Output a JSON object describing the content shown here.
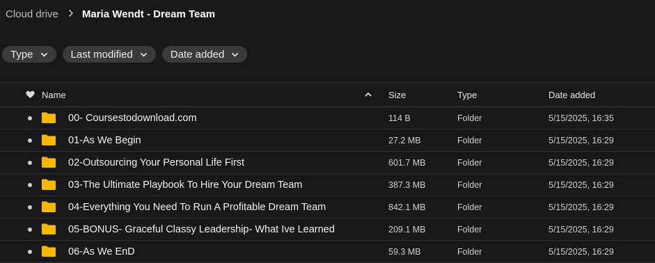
{
  "breadcrumb": {
    "root": "Cloud drive",
    "current": "Maria Wendt - Dream Team"
  },
  "filters": [
    {
      "label": "Type"
    },
    {
      "label": "Last modified"
    },
    {
      "label": "Date added"
    }
  ],
  "table": {
    "headers": {
      "name": "Name",
      "size": "Size",
      "type": "Type",
      "date_added": "Date added"
    },
    "rows": [
      {
        "name": "00- Coursestodownload.com",
        "size": "114 B",
        "type": "Folder",
        "date_added": "5/15/2025, 16:35"
      },
      {
        "name": "01-As We Begin",
        "size": "27.2 MB",
        "type": "Folder",
        "date_added": "5/15/2025, 16:29"
      },
      {
        "name": "02-Outsourcing Your Personal Life First",
        "size": "601.7 MB",
        "type": "Folder",
        "date_added": "5/15/2025, 16:29"
      },
      {
        "name": "03-The Ultimate Playbook To Hire Your Dream Team",
        "size": "387.3 MB",
        "type": "Folder",
        "date_added": "5/15/2025, 16:29"
      },
      {
        "name": "04-Everything You Need To Run A Profitable Dream Team",
        "size": "842.1 MB",
        "type": "Folder",
        "date_added": "5/15/2025, 16:29"
      },
      {
        "name": "05-BONUS- Graceful Classy Leadership- What Ive Learned",
        "size": "209.1 MB",
        "type": "Folder",
        "date_added": "5/15/2025, 16:29"
      },
      {
        "name": "06-As We EnD",
        "size": "59.3 MB",
        "type": "Folder",
        "date_added": "5/15/2025, 16:29"
      }
    ]
  },
  "icons": {
    "breadcrumb_separator": "chevron-right-icon",
    "filter_dropdown": "chevron-down-icon",
    "favorite_column": "heart-icon",
    "sort": "chevron-up-icon",
    "row_item": "folder-icon"
  },
  "colors": {
    "background": "#181818",
    "chip": "#3b3b3b",
    "folder": "#f5b800"
  }
}
